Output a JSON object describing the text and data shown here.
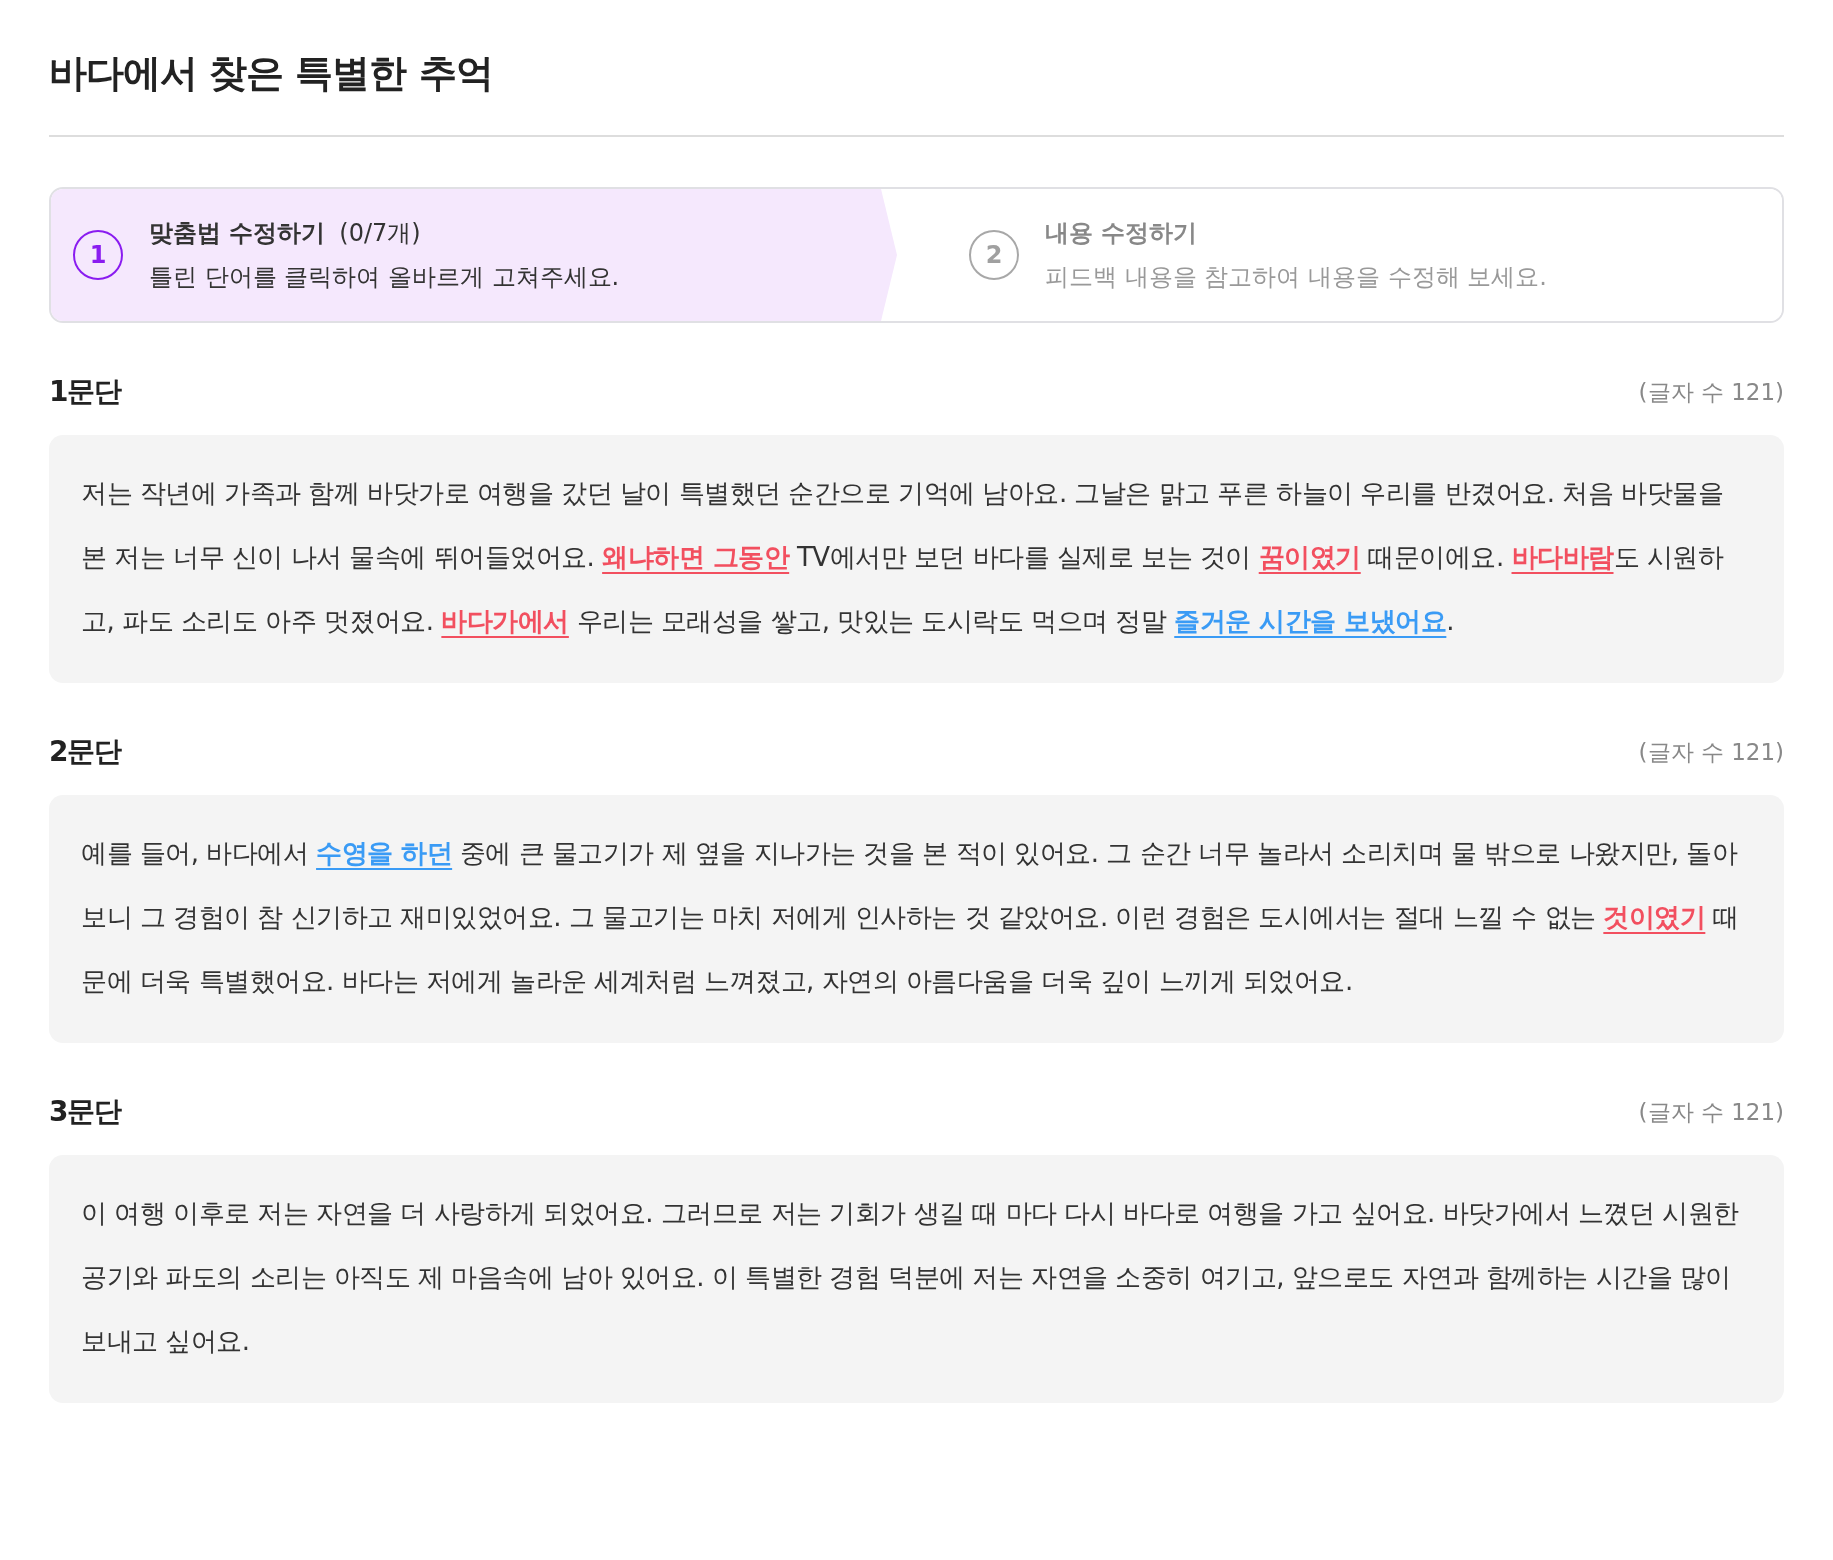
{
  "title": "바다에서 찾은 특별한 추억",
  "steps": [
    {
      "number": "1",
      "label": "맞춤법 수정하기",
      "count": "(0/7개)",
      "description": "틀린 단어를 클릭하여 올바르게 고쳐주세요.",
      "selected": true
    },
    {
      "number": "2",
      "label": "내용 수정하기",
      "description": "피드백 내용을 참고하여 내용을 수정해 보세요.",
      "selected": false
    }
  ],
  "paragraphs": [
    {
      "heading": "1문단",
      "char_count": "(글자 수 121)",
      "segments": [
        {
          "kind": "plain",
          "text": "저는 작년에 가족과 함께 바닷가로 여행을 갔던 날이 특별했던 순간으로 기억에 남아요. 그날은 맑고 푸른 하늘이 우리를 반겼어요. 처음 바닷물을 본 저는 너무 신이 나서 물속에 뛰어들었어요. "
        },
        {
          "kind": "spelling",
          "text": "왜냐하면 그동안"
        },
        {
          "kind": "plain",
          "text": " TV에서만 보던 바다를 실제로 보는 것이 "
        },
        {
          "kind": "spelling",
          "text": "꿈이였기"
        },
        {
          "kind": "plain",
          "text": " 때문이에요. "
        },
        {
          "kind": "spelling",
          "text": "바다바람"
        },
        {
          "kind": "plain",
          "text": "도 시원하고, 파도 소리도 아주 멋졌어요. "
        },
        {
          "kind": "spelling",
          "text": "바다가에서"
        },
        {
          "kind": "plain",
          "text": " 우리는 모래성을 쌓고, 맛있는 도시락도 먹으며 정말 "
        },
        {
          "kind": "feedback",
          "text": "즐거운 시간을 보냈어요"
        },
        {
          "kind": "plain",
          "text": "."
        }
      ]
    },
    {
      "heading": "2문단",
      "char_count": "(글자 수 121)",
      "segments": [
        {
          "kind": "plain",
          "text": "예를 들어, 바다에서 "
        },
        {
          "kind": "feedback",
          "text": "수영을 하던"
        },
        {
          "kind": "plain",
          "text": " 중에 큰 물고기가 제 옆을 지나가는 것을 본 적이 있어요. 그 순간 너무 놀라서 소리치며 물 밖으로 나왔지만, 돌아보니 그 경험이 참 신기하고 재미있었어요. 그 물고기는 마치 저에게 인사하는 것 같았어요. 이런 경험은 도시에서는 절대 느낄 수 없는 "
        },
        {
          "kind": "spelling",
          "text": "것이였기"
        },
        {
          "kind": "plain",
          "text": " 때문에 더욱 특별했어요. 바다는 저에게 놀라운 세계처럼 느껴졌고, 자연의 아름다움을 더욱 깊이 느끼게 되었어요."
        }
      ]
    },
    {
      "heading": "3문단",
      "char_count": "(글자 수 121)",
      "segments": [
        {
          "kind": "plain",
          "text": "이 여행 이후로 저는 자연을 더 사랑하게 되었어요. 그러므로 저는 기회가 생길 때 마다 다시 바다로 여행을 가고 싶어요. 바닷가에서 느꼈던 시원한 공기와 파도의 소리는 아직도 제 마음속에 남아 있어요. 이 특별한 경험 덕분에 저는 자연을 소중히 여기고, 앞으로도 자연과 함께하는 시간을 많이 보내고 싶어요."
        }
      ]
    }
  ]
}
